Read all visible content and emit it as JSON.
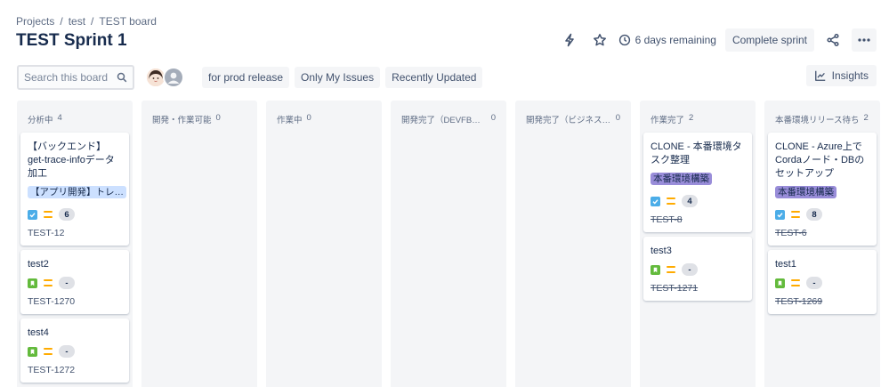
{
  "breadcrumb": [
    "Projects",
    "test",
    "TEST board"
  ],
  "title": "TEST Sprint 1",
  "header": {
    "remaining": "6 days remaining",
    "complete_sprint": "Complete sprint"
  },
  "search": {
    "placeholder": "Search this board"
  },
  "filters": [
    "for prod release",
    "Only My Issues",
    "Recently Updated"
  ],
  "insights": "Insights",
  "colors": {
    "accent": "#0052cc",
    "column_bg": "#f4f5f7",
    "task": "#4bade8",
    "story": "#63ba3c",
    "priority_medium": "#ffab00",
    "epic_blue": "#cce0ff",
    "epic_purple": "#998dd9"
  },
  "columns": [
    {
      "name": "分析中",
      "count": "4",
      "cards": [
        {
          "title": "【バックエンド】get-trace-infoデータ加工",
          "epic": "【アプリ開発】トレ…",
          "epic_color": "blue",
          "type": "task-icon",
          "estimate": "6",
          "key": "TEST-12",
          "done": false
        },
        {
          "title": "test2",
          "epic": "",
          "type": "story-icon",
          "estimate": "-",
          "key": "TEST-1270",
          "done": false
        },
        {
          "title": "test4",
          "epic": "",
          "type": "story-icon",
          "estimate": "-",
          "key": "TEST-1272",
          "done": false
        }
      ]
    },
    {
      "name": "開発・作業可能",
      "count": "0",
      "cards": []
    },
    {
      "name": "作業中",
      "count": "0",
      "cards": []
    },
    {
      "name": "開発完了（DEVFB待ち）",
      "count": "0",
      "cards": []
    },
    {
      "name": "開発完了（ビジネスFB…",
      "count": "0",
      "cards": []
    },
    {
      "name": "作業完了",
      "count": "2",
      "cards": [
        {
          "title": "CLONE - 本番環境タスク整理",
          "epic": "本番環境構築",
          "epic_color": "purple",
          "type": "task-icon",
          "estimate": "4",
          "key": "TEST-8",
          "done": true
        },
        {
          "title": "test3",
          "epic": "",
          "type": "story-icon",
          "estimate": "-",
          "key": "TEST-1271",
          "done": true
        }
      ]
    },
    {
      "name": "本番環境リリース待ち",
      "count": "2",
      "cards": [
        {
          "title": "CLONE - Azure上でCordaノード・DBのセットアップ",
          "epic": "本番環境構築",
          "epic_color": "purple",
          "type": "task-icon",
          "estimate": "8",
          "key": "TEST-6",
          "done": true
        },
        {
          "title": "test1",
          "epic": "",
          "type": "story-icon",
          "estimate": "-",
          "key": "TEST-1269",
          "done": true
        }
      ]
    }
  ]
}
